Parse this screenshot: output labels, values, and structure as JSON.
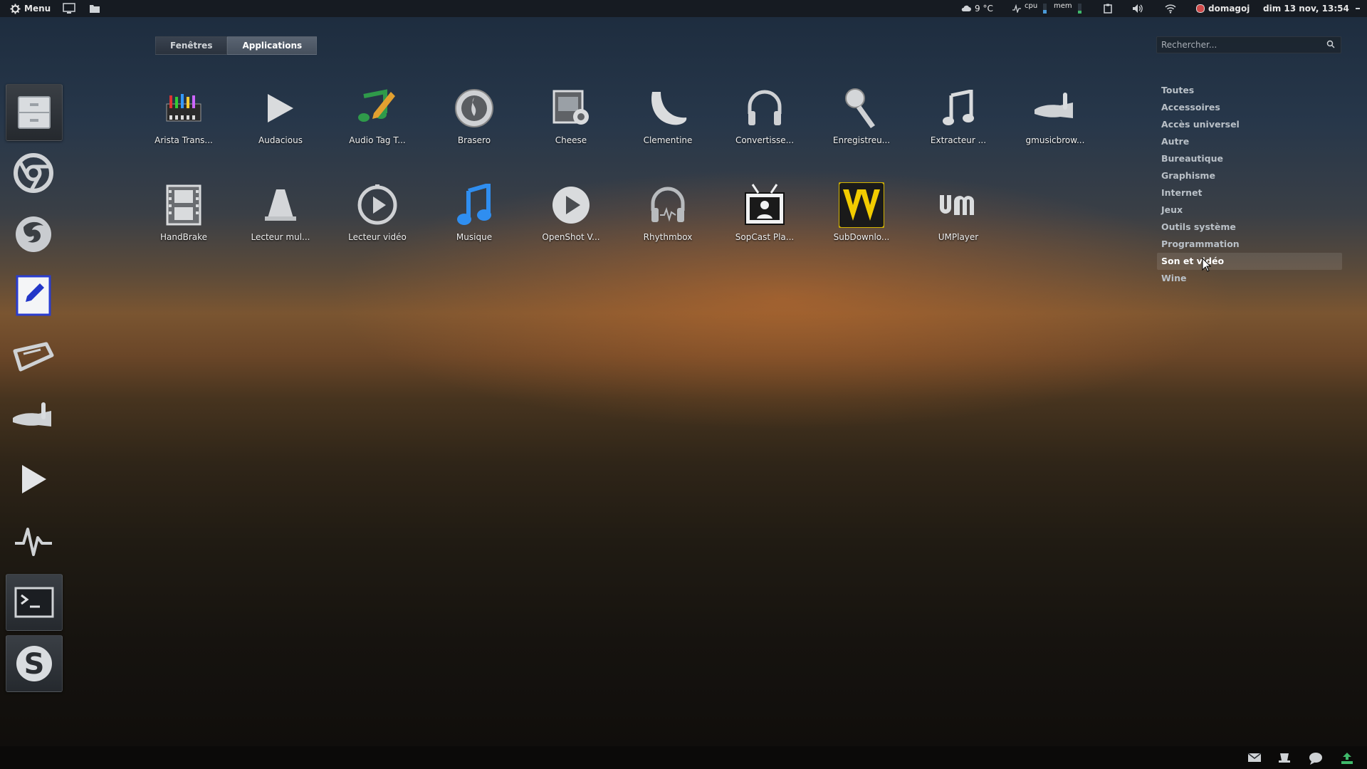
{
  "top_panel": {
    "menu_label": "Menu",
    "weather": "9 °C",
    "cpu_label": "cpu",
    "mem_label": "mem",
    "user": "domagoj",
    "datetime": "dim 13 nov, 13:54"
  },
  "tabs": [
    {
      "label": "Fenêtres",
      "active": false
    },
    {
      "label": "Applications",
      "active": true
    }
  ],
  "search": {
    "placeholder": "Rechercher..."
  },
  "categories": [
    {
      "label": "Toutes"
    },
    {
      "label": "Accessoires"
    },
    {
      "label": "Accès universel"
    },
    {
      "label": "Autre"
    },
    {
      "label": "Bureautique"
    },
    {
      "label": "Graphisme"
    },
    {
      "label": "Internet"
    },
    {
      "label": "Jeux"
    },
    {
      "label": "Outils système"
    },
    {
      "label": "Programmation"
    },
    {
      "label": "Son et vidéo",
      "active": true
    },
    {
      "label": "Wine"
    }
  ],
  "apps": [
    {
      "label": "Arista Trans...",
      "icon": "arista-icon"
    },
    {
      "label": "Audacious",
      "icon": "audacious-icon"
    },
    {
      "label": "Audio Tag T...",
      "icon": "audio-tag-icon"
    },
    {
      "label": "Brasero",
      "icon": "brasero-icon"
    },
    {
      "label": "Cheese",
      "icon": "cheese-icon"
    },
    {
      "label": "Clementine",
      "icon": "clementine-icon"
    },
    {
      "label": "Convertisse...",
      "icon": "headphones-icon"
    },
    {
      "label": "Enregistreu...",
      "icon": "microphone-icon"
    },
    {
      "label": "Extracteur ...",
      "icon": "music-note-icon"
    },
    {
      "label": "gmusicbrow...",
      "icon": "gmusicbrowser-icon"
    },
    {
      "label": "HandBrake",
      "icon": "handbrake-icon"
    },
    {
      "label": "Lecteur mul...",
      "icon": "vlc-cone-icon"
    },
    {
      "label": "Lecteur vidéo",
      "icon": "video-player-icon"
    },
    {
      "label": "Musique",
      "icon": "musique-icon"
    },
    {
      "label": "OpenShot V...",
      "icon": "openshot-icon"
    },
    {
      "label": "Rhythmbox",
      "icon": "rhythmbox-icon"
    },
    {
      "label": "SopCast Pla...",
      "icon": "sopcast-icon"
    },
    {
      "label": "SubDownlo...",
      "icon": "subdownloader-icon"
    },
    {
      "label": "UMPlayer",
      "icon": "umplayer-icon"
    }
  ],
  "dock": [
    {
      "icon": "file-cabinet-icon"
    },
    {
      "icon": "chrome-icon"
    },
    {
      "icon": "firefox-icon"
    },
    {
      "icon": "text-editor-icon"
    },
    {
      "icon": "ticket-icon"
    },
    {
      "icon": "gmusicbrowser-dock-icon"
    },
    {
      "icon": "play-icon"
    },
    {
      "icon": "system-monitor-icon"
    },
    {
      "icon": "terminal-icon"
    },
    {
      "icon": "skype-icon"
    }
  ],
  "bottom_bar": {
    "icons": [
      "mail-icon",
      "pin-icon",
      "chat-icon",
      "update-icon"
    ]
  }
}
